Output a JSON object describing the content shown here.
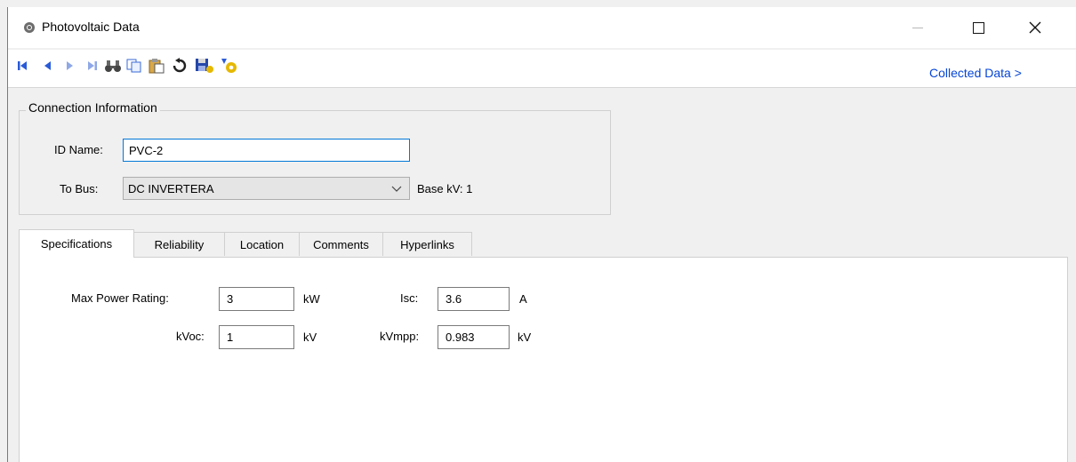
{
  "window": {
    "title": "Photovoltaic Data"
  },
  "toolbar": {
    "icons": [
      "first-record-icon",
      "previous-record-icon",
      "next-record-icon",
      "last-record-icon",
      "find-icon",
      "copy-icon",
      "paste-icon",
      "undo-icon",
      "save-icon",
      "settings-icon"
    ],
    "collected_data_link": "Collected Data >"
  },
  "connection": {
    "group_title": "Connection Information",
    "id_label": "ID Name:",
    "id_value": "PVC-2",
    "bus_label": "To Bus:",
    "bus_value": "DC INVERTERA",
    "base_kv": "Base kV: 1"
  },
  "tabs": [
    {
      "label": "Specifications",
      "active": true
    },
    {
      "label": "Reliability",
      "active": false
    },
    {
      "label": "Location",
      "active": false
    },
    {
      "label": "Comments",
      "active": false
    },
    {
      "label": "Hyperlinks",
      "active": false
    }
  ],
  "specs": {
    "max_power_label": "Max Power Rating:",
    "max_power_value": "3",
    "max_power_unit": "kW",
    "isc_label": "Isc:",
    "isc_value": "3.6",
    "isc_unit": "A",
    "kvoc_label": "kVoc:",
    "kvoc_value": "1",
    "kvoc_unit": "kV",
    "kvmpp_label": "kVmpp:",
    "kvmpp_value": "0.983",
    "kvmpp_unit": "kV"
  },
  "colors": {
    "link": "#0645d6",
    "focus_border": "#0078d7"
  }
}
